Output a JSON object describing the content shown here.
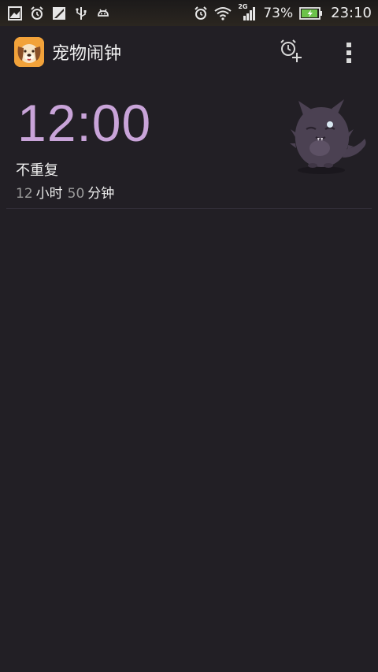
{
  "status_bar": {
    "battery": "73%",
    "time": "23:10",
    "network": "2G",
    "left_icons": [
      "image-notification-icon",
      "alarm-notification-icon",
      "signal-notification-icon",
      "usb-icon",
      "android-debug-icon"
    ],
    "right_icons": [
      "alarm-clock-icon",
      "wifi-icon",
      "cellular-signal-icon",
      "battery-charging-icon"
    ]
  },
  "app_bar": {
    "title": "宠物闹钟",
    "logo_icon": "pet-dog-logo-icon",
    "actions": [
      "add-alarm-icon",
      "overflow-menu-icon"
    ]
  },
  "alarm": {
    "time": "12:00",
    "repeat": "不重复",
    "remaining": {
      "hours": "12",
      "hours_unit": "小时",
      "minutes": "50",
      "minutes_unit": "分钟"
    },
    "pet_icon": "purple-furry-cat-icon"
  },
  "colors": {
    "background": "#221f25",
    "time_accent": "#c9a4d9",
    "pet": "#4b4152"
  }
}
